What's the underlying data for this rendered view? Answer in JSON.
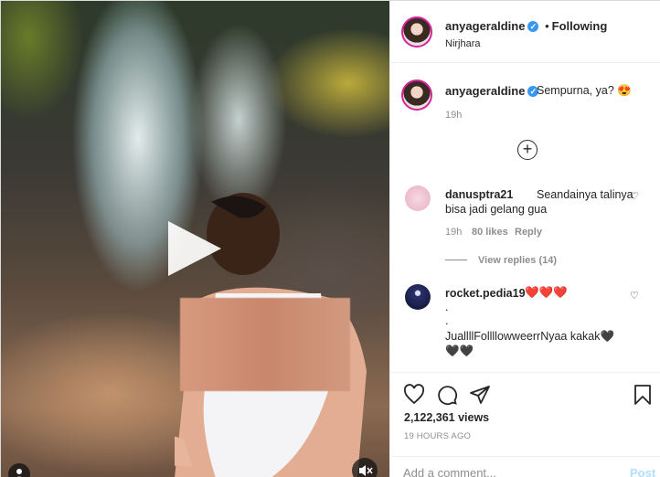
{
  "post": {
    "author": "anyageraldine",
    "follow_status": "Following",
    "location": "Nirjhara"
  },
  "caption": {
    "username": "anyageraldine",
    "text": "Sempurna, ya? 😍",
    "time": "19h"
  },
  "comments": [
    {
      "username": "danusptra21",
      "text_line1": "Seandainya talinya",
      "text_line2": "bisa jadi gelang gua",
      "time": "19h",
      "likes": "80 likes",
      "reply": "Reply",
      "view_replies": "View replies (14)"
    },
    {
      "username": "rocket.pedia19",
      "emoji": "❤️❤️❤️",
      "line_dot1": ".",
      "line_dot2": ".",
      "line3": "JuallllFollllowweerrNyaa kakak🖤",
      "line4": "🖤🖤"
    }
  ],
  "stats": {
    "views": "2,122,361 views",
    "age": "19 HOURS AGO"
  },
  "composer": {
    "placeholder": "Add a comment...",
    "post_label": "Post"
  },
  "icons": {
    "verified": "verified-badge-icon",
    "like": "heart-icon",
    "comment": "comment-bubble-icon",
    "share": "paper-plane-icon",
    "save": "bookmark-icon",
    "add": "plus-circle-icon",
    "play": "play-icon",
    "mute": "speaker-muted-icon"
  },
  "colors": {
    "verified": "#3897f0",
    "muted_text": "#8e8e8e",
    "post_disabled": "#b2dffc",
    "heart_red": "#ed4956"
  }
}
